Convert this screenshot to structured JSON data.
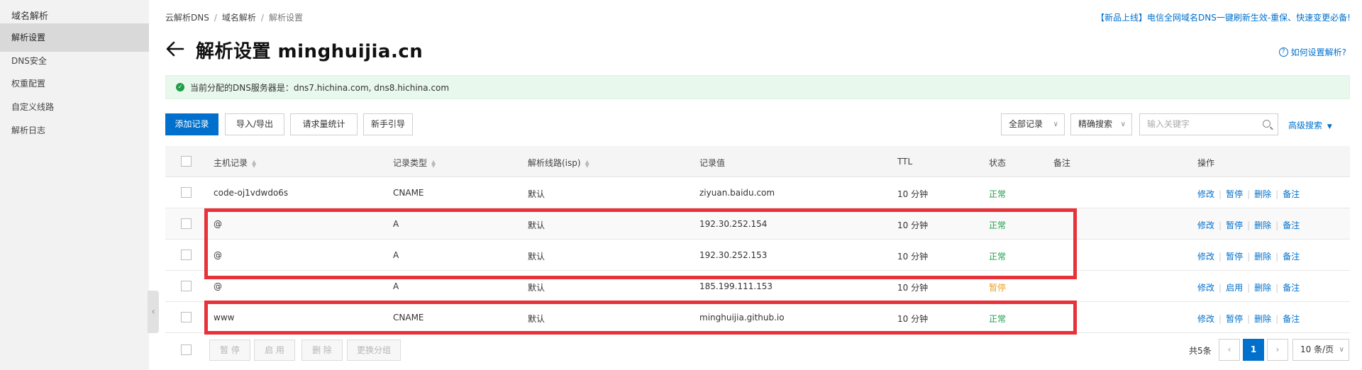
{
  "sidebar": {
    "title": "域名解析",
    "items": [
      {
        "label": "解析设置",
        "active": true
      },
      {
        "label": "DNS安全",
        "active": false
      },
      {
        "label": "权重配置",
        "active": false
      },
      {
        "label": "自定义线路",
        "active": false
      },
      {
        "label": "解析日志",
        "active": false
      }
    ],
    "collapse_glyph": "‹"
  },
  "breadcrumb": {
    "items": [
      "云解析DNS",
      "域名解析",
      "解析设置"
    ],
    "separator": "/"
  },
  "promo_text": "【新品上线】电信全网域名DNS一键刷新生效-重保、快速变更必备!",
  "page": {
    "title": "解析设置 minghuijia.cn",
    "help_text": "如何设置解析?"
  },
  "notice": {
    "text": "当前分配的DNS服务器是：dns7.hichina.com, dns8.hichina.com"
  },
  "toolbar": {
    "add": "添加记录",
    "import_export": "导入/导出",
    "stats": "请求量统计",
    "guide": "新手引导",
    "filter_all": "全部记录",
    "filter_exact": "精确搜索",
    "search_placeholder": "输入关键字",
    "advanced": "高级搜索"
  },
  "table": {
    "headers": {
      "host": "主机记录",
      "type": "记录类型",
      "line": "解析线路(isp)",
      "value": "记录值",
      "ttl": "TTL",
      "status": "状态",
      "remark": "备注",
      "ops": "操作"
    },
    "rows": [
      {
        "host": "code-oj1vdwdo6s",
        "type": "CNAME",
        "line": "默认",
        "value": "ziyuan.baidu.com",
        "ttl": "10 分钟",
        "status": "正常",
        "ops": [
          "修改",
          "暂停",
          "删除",
          "备注"
        ]
      },
      {
        "host": "@",
        "type": "A",
        "line": "默认",
        "value": "192.30.252.154",
        "ttl": "10 分钟",
        "status": "正常",
        "ops": [
          "修改",
          "暂停",
          "删除",
          "备注"
        ]
      },
      {
        "host": "@",
        "type": "A",
        "line": "默认",
        "value": "192.30.252.153",
        "ttl": "10 分钟",
        "status": "正常",
        "ops": [
          "修改",
          "暂停",
          "删除",
          "备注"
        ]
      },
      {
        "host": "@",
        "type": "A",
        "line": "默认",
        "value": "185.199.111.153",
        "ttl": "10 分钟",
        "status": "暂停",
        "ops": [
          "修改",
          "启用",
          "删除",
          "备注"
        ]
      },
      {
        "host": "www",
        "type": "CNAME",
        "line": "默认",
        "value": "minghuijia.github.io",
        "ttl": "10 分钟",
        "status": "正常",
        "ops": [
          "修改",
          "暂停",
          "删除",
          "备注"
        ]
      }
    ]
  },
  "footer": {
    "pause": "暂 停",
    "enable": "启 用",
    "delete": "删 除",
    "change_group": "更换分组",
    "total": "共5条",
    "current_page": "1",
    "prev": "‹",
    "next": "›",
    "page_size": "10 条/页"
  },
  "colors": {
    "accent": "#0070cc",
    "ok": "#1e9e4a",
    "paused": "#f0a020",
    "highlight": "#e8323a"
  }
}
